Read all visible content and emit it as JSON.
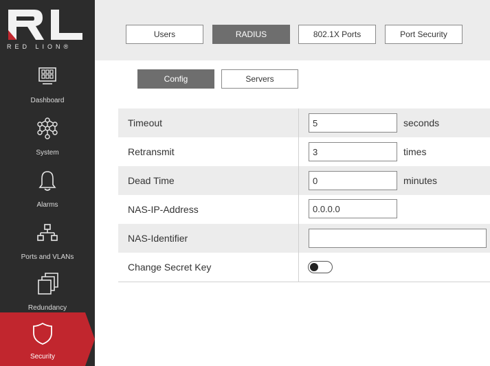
{
  "brand": {
    "logo_letters": "RL",
    "logo_text": "RED LION®"
  },
  "sidebar": {
    "items": [
      {
        "label": "Dashboard",
        "icon": "dashboard-icon"
      },
      {
        "label": "System",
        "icon": "system-network-icon"
      },
      {
        "label": "Alarms",
        "icon": "bell-icon"
      },
      {
        "label": "Ports and VLANs",
        "icon": "network-ports-icon"
      },
      {
        "label": "Redundancy",
        "icon": "redundancy-icon"
      },
      {
        "label": "Security",
        "icon": "shield-icon",
        "active": true
      }
    ]
  },
  "tabs": [
    "Users",
    "RADIUS",
    "802.1X Ports",
    "Port Security"
  ],
  "active_tab": "RADIUS",
  "subtabs": [
    "Config",
    "Servers"
  ],
  "active_subtab": "Config",
  "form": {
    "timeout": {
      "label": "Timeout",
      "value": "5",
      "unit": "seconds"
    },
    "retransmit": {
      "label": "Retransmit",
      "value": "3",
      "unit": "times"
    },
    "dead_time": {
      "label": "Dead Time",
      "value": "0",
      "unit": "minutes"
    },
    "nas_ip": {
      "label": "NAS-IP-Address",
      "value": "0.0.0.0"
    },
    "nas_id": {
      "label": "NAS-Identifier",
      "value": ""
    },
    "change_secret": {
      "label": "Change Secret Key",
      "state": "off"
    }
  },
  "colors": {
    "accent": "#c1262e",
    "sidebar_bg": "#2c2c2c",
    "active_tab_bg": "#6e6e6e"
  }
}
